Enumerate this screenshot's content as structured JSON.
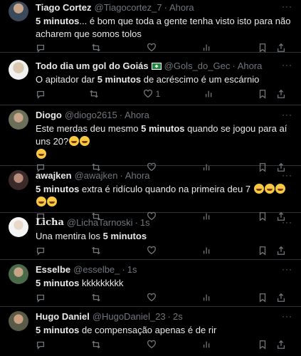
{
  "tweets": [
    {
      "name": "Tiago Cortez",
      "handle": "@Tiagocortez_7",
      "time": "Ahora",
      "bold": "5 minutos",
      "text": "... é bom que toda a gente tenha visto isto para não acharem que somos tolos",
      "reply_count": "",
      "retweet_count": "",
      "like_count": "",
      "views": ""
    },
    {
      "name": "Todo dia um gol do Goiás",
      "handle": "@Gols_do_Gec",
      "time": "Ahora",
      "text_before": "O apitador dar ",
      "bold": "5 minutos",
      "text": " de acréscimo é um escárnio",
      "like_count": "1"
    },
    {
      "name": "Diogo",
      "handle": "@diogo2615",
      "time": "Ahora",
      "text_before": "Este merdas deu mesmo ",
      "bold": "5 minutos",
      "text": " quando se jogou para aí uns 20?"
    },
    {
      "name": "awajken",
      "handle": "@awajken",
      "time": "Ahora",
      "bold": "5 minutos",
      "text": " extra é ridículo quando na primeira deu 7"
    },
    {
      "name": "Licha",
      "handle": "@LichaTarnoski",
      "time": "1s",
      "text_before": "Una mentira los ",
      "bold": "5 minutos",
      "text": ""
    },
    {
      "name": "Esselbe",
      "handle": "@esselbe_",
      "time": "1s",
      "bold": "5 minutos",
      "text": " kkkkkkkkk"
    },
    {
      "name": "Hugo Daniel",
      "handle": "@HugoDaniel_23",
      "time": "2s",
      "bold": "5 minutos",
      "text": " de compensação apenas é de rir"
    }
  ],
  "icons": {
    "reply": "reply-icon",
    "retweet": "retweet-icon",
    "like": "heart-icon",
    "views": "analytics-icon",
    "share": "share-icon",
    "more": "more-icon"
  },
  "colors": {
    "background": "#000000",
    "text": "#e7e9ea",
    "muted": "#71767b",
    "divider": "#2f3336"
  }
}
